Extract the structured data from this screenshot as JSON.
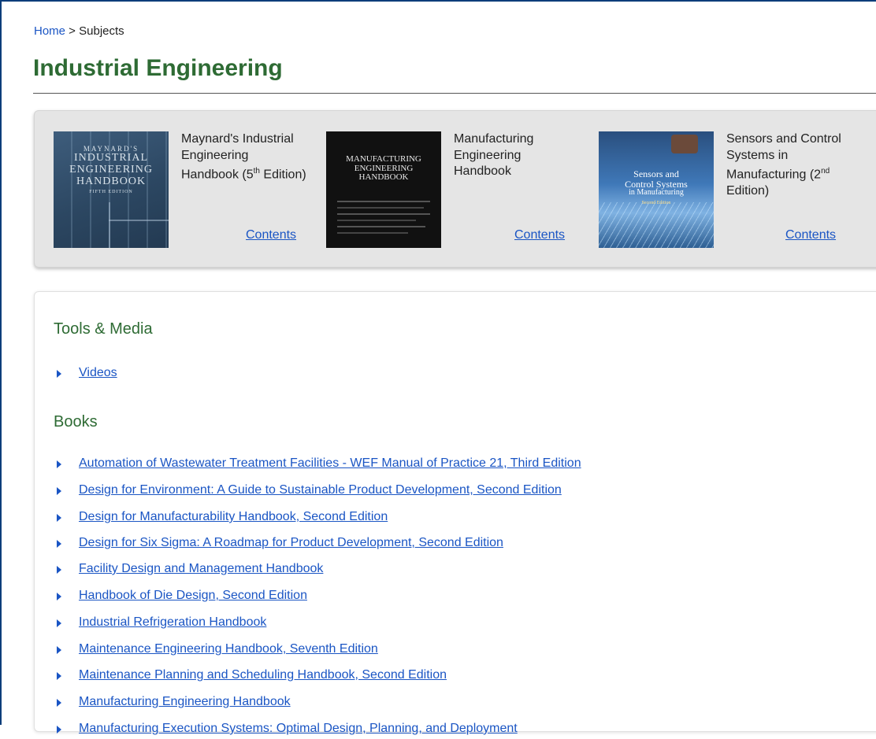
{
  "breadcrumb": {
    "home": "Home",
    "separator": " > ",
    "current": "Subjects"
  },
  "page_title": "Industrial Engineering",
  "featured": [
    {
      "cover_lines": [
        "MAYNARD'S",
        "INDUSTRIAL",
        "ENGINEERING",
        "HANDBOOK",
        "FIFTH EDITION"
      ],
      "title_parts": [
        "Maynard's Industrial Engineering Handbook (5",
        "th",
        " Edition)"
      ],
      "contents_label": "Contents"
    },
    {
      "cover_lines": [
        "MANUFACTURING",
        "ENGINEERING",
        "HANDBOOK"
      ],
      "title_parts": [
        "Manufacturing Engineering Handbook"
      ],
      "contents_label": "Contents"
    },
    {
      "cover_lines": [
        "Sensors and",
        "Control Systems",
        "in Manufacturing",
        "Second Edition"
      ],
      "title_parts": [
        "Sensors and Control Systems in Manufacturing (2",
        "nd",
        " Edition)"
      ],
      "contents_label": "Contents"
    }
  ],
  "tools_media": {
    "heading": "Tools & Media",
    "items": [
      "Videos"
    ]
  },
  "books": {
    "heading": "Books",
    "items": [
      "Automation of Wastewater Treatment Facilities - WEF Manual of Practice 21, Third Edition",
      "Design for Environment: A Guide to Sustainable Product Development, Second Edition",
      "Design for Manufacturability Handbook, Second Edition",
      "Design for Six Sigma: A Roadmap for Product Development, Second Edition",
      "Facility Design and Management Handbook",
      "Handbook of Die Design, Second Edition",
      "Industrial Refrigeration Handbook",
      "Maintenance Engineering Handbook, Seventh Edition",
      "Maintenance Planning and Scheduling Handbook, Second Edition",
      "Manufacturing Engineering Handbook",
      "Manufacturing Execution Systems: Optimal Design, Planning, and Deployment"
    ]
  },
  "colors": {
    "link": "#1a55c4",
    "heading": "#2e6b34",
    "panel": "#e5e5e5"
  }
}
